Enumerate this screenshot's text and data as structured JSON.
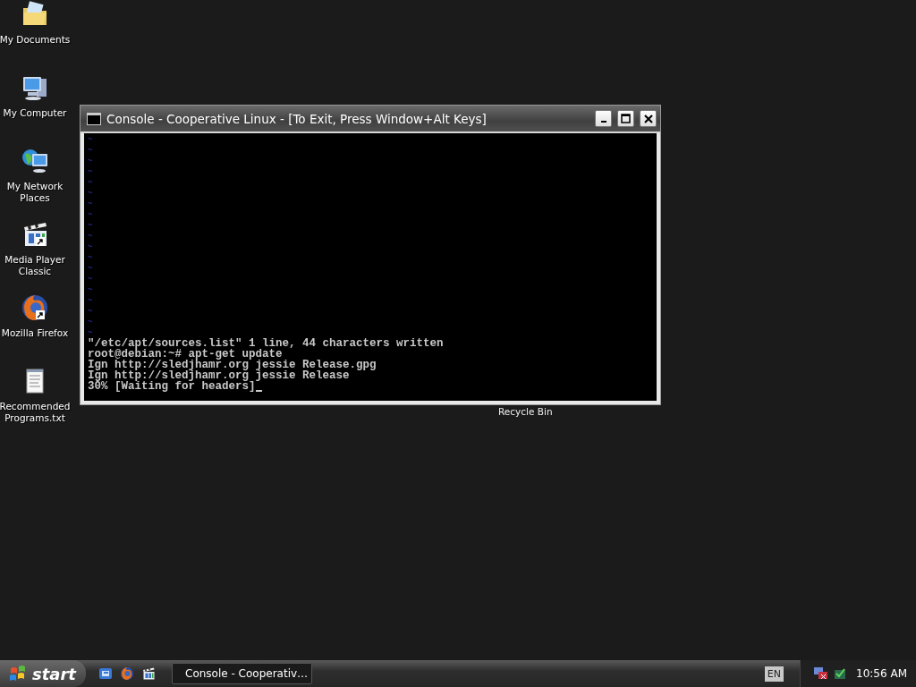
{
  "desktop_icons": [
    {
      "label": "My Documents",
      "kind": "folder",
      "shortcut": false
    },
    {
      "label": "My Computer",
      "kind": "computer",
      "shortcut": false
    },
    {
      "label": "My Network Places",
      "kind": "network",
      "shortcut": false
    },
    {
      "label": "Media Player Classic",
      "kind": "player",
      "shortcut": true
    },
    {
      "label": "Mozilla Firefox",
      "kind": "browser",
      "shortcut": true
    },
    {
      "label": "Recommended Programs.txt",
      "kind": "text",
      "shortcut": false
    }
  ],
  "hidden_icon_label": "Recycle Bin",
  "window": {
    "title": "Console - Cooperative Linux - [To Exit, Press Window+Alt Keys]",
    "empty_lines": [
      "~",
      "~",
      "~",
      "~",
      "~",
      "~",
      "~",
      "~",
      "~",
      "~",
      "~",
      "~",
      "~",
      "~",
      "~",
      "~",
      "~",
      "~",
      "~"
    ],
    "lines": [
      "\"/etc/apt/sources.list\" 1 line, 44 characters written",
      "root@debian:~# apt-get update",
      "Ign http://sledjhamr.org jessie Release.gpg",
      "Ign http://sledjhamr.org jessie Release",
      "30% [Waiting for headers]"
    ]
  },
  "taskbar": {
    "start": "start",
    "quick_launch": [
      {
        "kind": "ie"
      },
      {
        "kind": "browser"
      },
      {
        "kind": "player"
      }
    ],
    "tasks": [
      {
        "label": "Console - Cooperativ…",
        "selected": false
      }
    ],
    "language": "EN",
    "clock": "10:56 AM"
  }
}
